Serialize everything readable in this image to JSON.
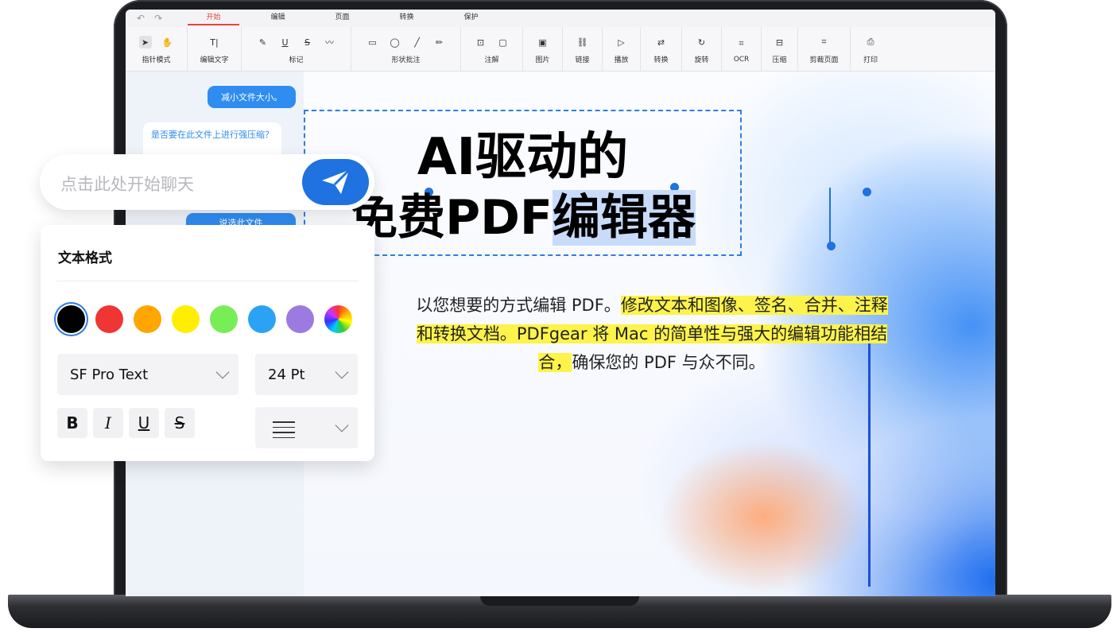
{
  "toolbar": {
    "tabs": [
      {
        "label": "开始"
      },
      {
        "label": "编辑"
      },
      {
        "label": "页面"
      },
      {
        "label": "转换"
      },
      {
        "label": "保护"
      }
    ],
    "active_tab": "开始",
    "active_color": "#e8453c",
    "groups": [
      {
        "label": "指针模式",
        "icons": [
          "pointer-icon",
          "hand-icon"
        ]
      },
      {
        "label": "编辑文字",
        "icons": [
          "edit-text-icon"
        ]
      },
      {
        "label": "标记",
        "icons": [
          "highlight-icon",
          "underline-icon",
          "strikethrough-icon",
          "squiggly-icon"
        ]
      },
      {
        "label": "形状批注",
        "icons": [
          "rectangle-icon",
          "ellipse-icon",
          "line-icon",
          "pencil-icon"
        ]
      },
      {
        "label": "注解",
        "icons": [
          "textbox-icon",
          "comment-icon"
        ]
      },
      {
        "label": "图片",
        "icons": [
          "image-icon"
        ]
      },
      {
        "label": "链接",
        "icons": [
          "link-icon"
        ]
      },
      {
        "label": "播放",
        "icons": [
          "play-icon"
        ]
      },
      {
        "label": "转换",
        "icons": [
          "convert-icon"
        ]
      },
      {
        "label": "旋转",
        "icons": [
          "rotate-icon"
        ]
      },
      {
        "label": "OCR",
        "icons": [
          "ocr-icon"
        ]
      },
      {
        "label": "压缩",
        "icons": [
          "compress-icon"
        ]
      },
      {
        "label": "剪裁页面",
        "icons": [
          "crop-icon"
        ]
      },
      {
        "label": "打印",
        "icons": [
          "print-icon"
        ]
      }
    ]
  },
  "chat": {
    "user_message": "减小文件大小。",
    "assistant_message": "是否要在此文件上进行强压缩？",
    "action_button": "说选此文件",
    "input_placeholder": "点击此处开始聊天"
  },
  "document": {
    "title_line1": "AI驱动的",
    "title_line2_prefix": "免费PDF",
    "title_line2_selected": "编辑器",
    "description_plain_1": "以您想要的方式编辑 PDF。",
    "description_highlight": "修改文本和图像、签名、合并、注释和转换文档。PDFgear 将 Mac 的简单性与强大的编辑功能相结合，",
    "description_plain_2": "确保您的 PDF 与众不同。",
    "highlight_color": "#fdf34a",
    "selection_color": "#c8dcfa"
  },
  "format_panel": {
    "title": "文本格式",
    "colors": [
      "#000000",
      "#f03535",
      "#ffa600",
      "#ffee00",
      "#77ee55",
      "#2aa3f5",
      "#9b7be0",
      "rainbow"
    ],
    "selected_color": "#000000",
    "font_family": "SF Pro Text",
    "font_size": "24 Pt",
    "styles": {
      "bold": "B",
      "italic": "I",
      "underline": "U",
      "strike": "S"
    }
  }
}
